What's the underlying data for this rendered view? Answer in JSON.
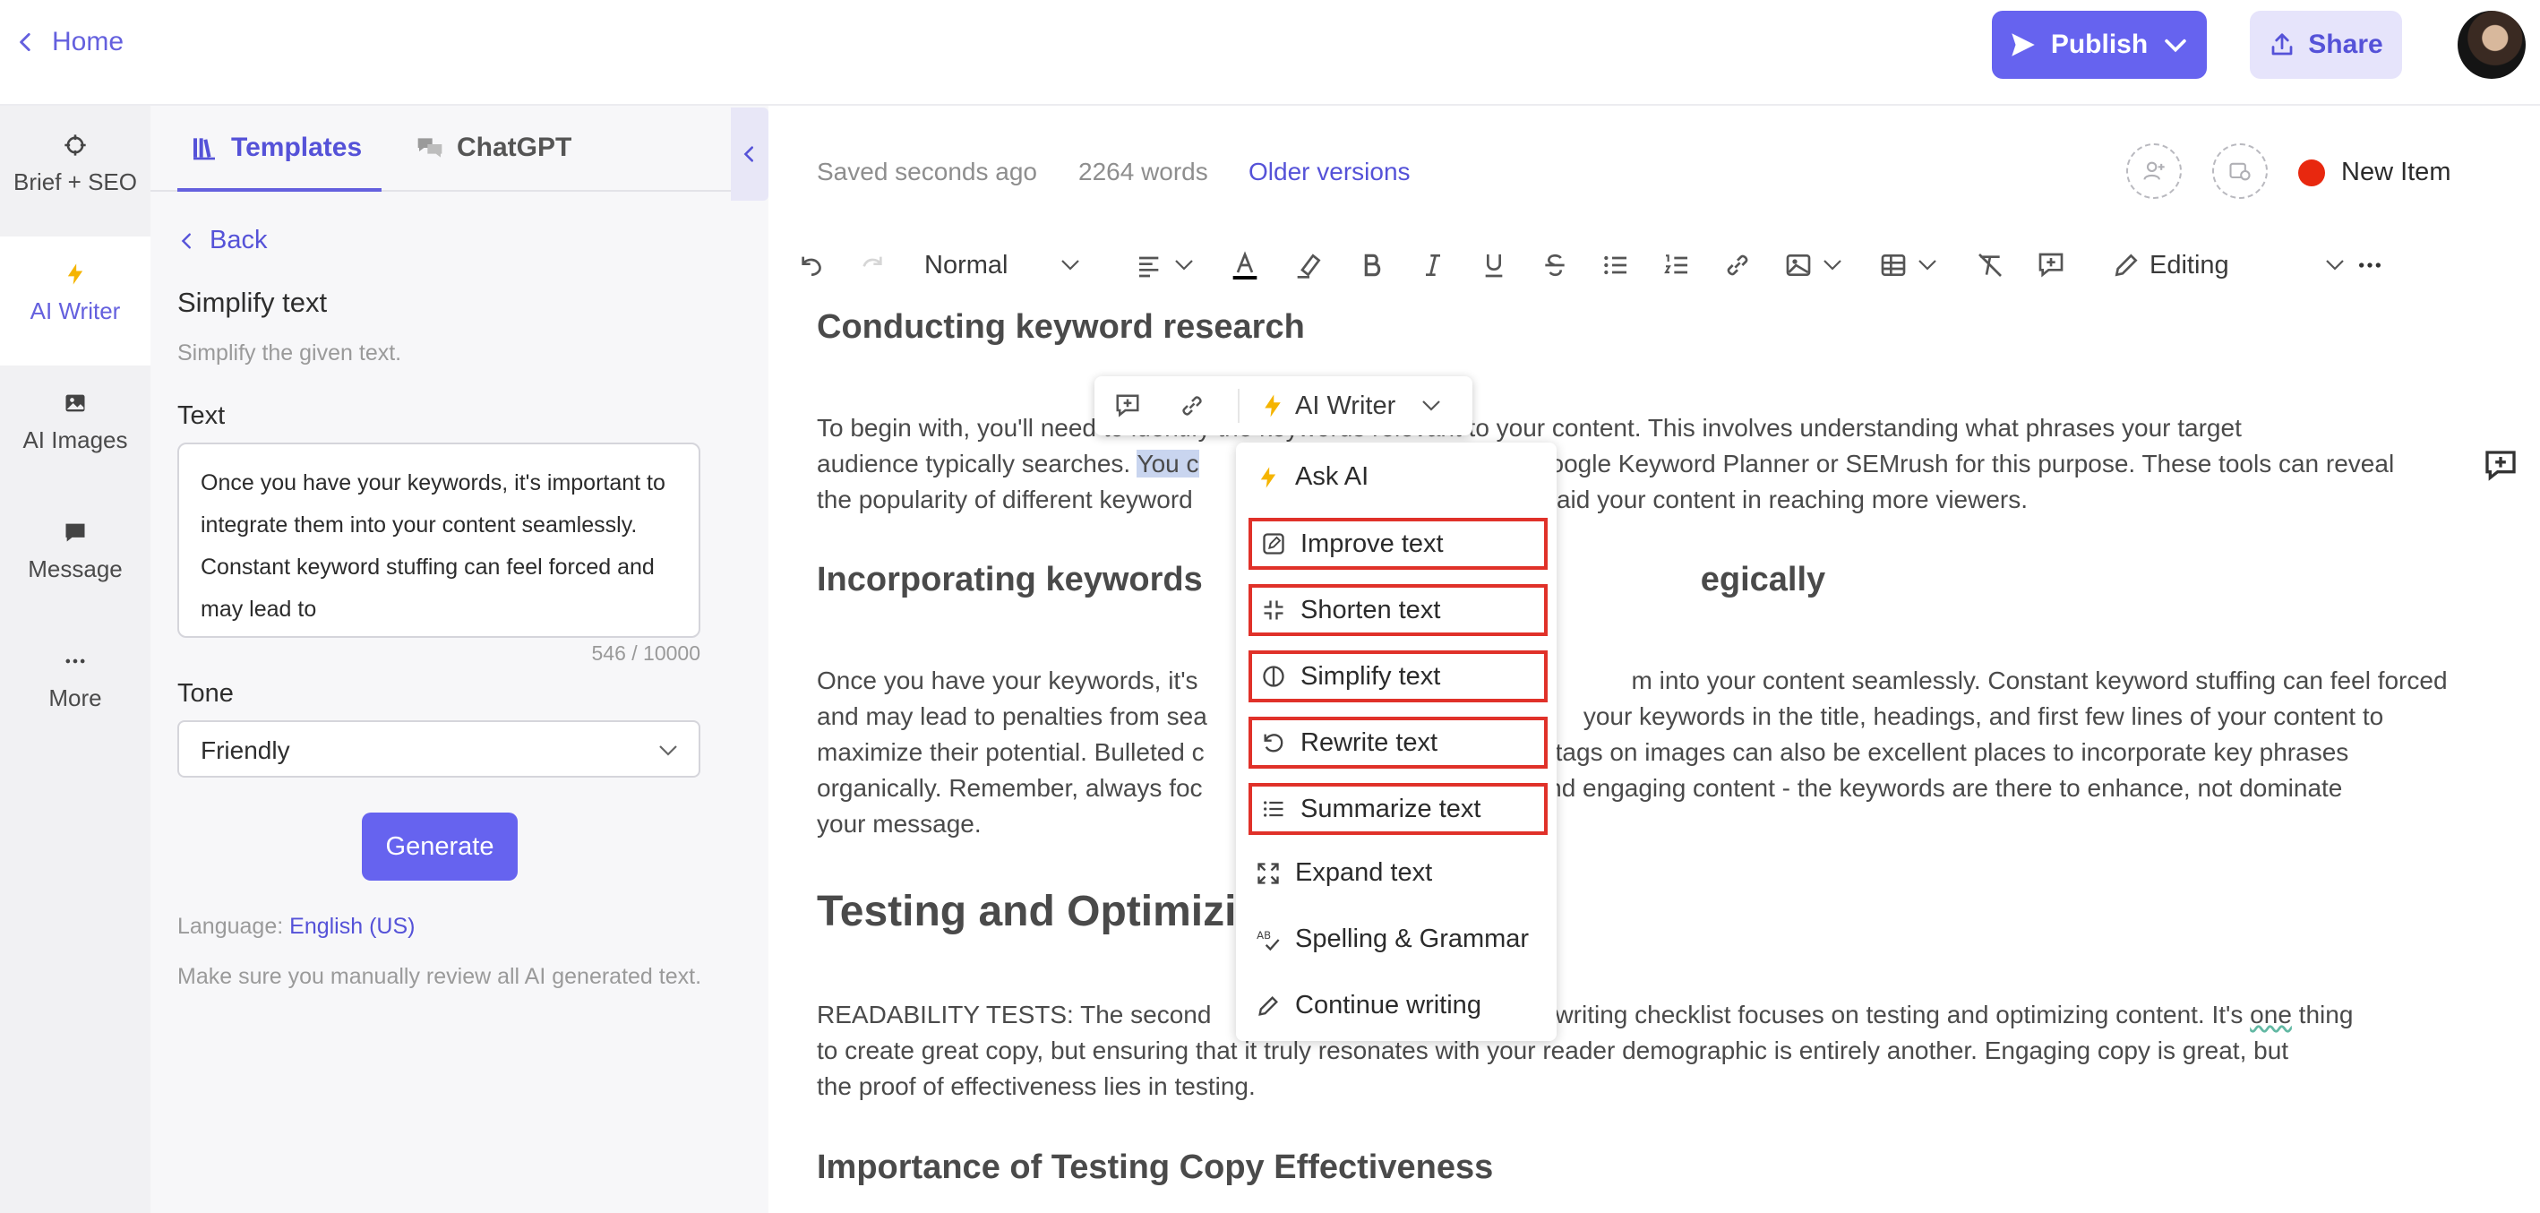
{
  "header": {
    "home_label": "Home",
    "publish_label": "Publish",
    "share_label": "Share"
  },
  "rail": {
    "items": [
      {
        "label": "Brief + SEO",
        "icon": "crosshair-icon"
      },
      {
        "label": "AI Writer",
        "icon": "lightning-icon"
      },
      {
        "label": "AI Images",
        "icon": "image-icon"
      },
      {
        "label": "Message",
        "icon": "message-icon"
      },
      {
        "label": "More",
        "icon": "dots-icon"
      }
    ]
  },
  "panel": {
    "tabs": [
      {
        "label": "Templates",
        "icon": "library-icon"
      },
      {
        "label": "ChatGPT",
        "icon": "chat-bubbles-icon"
      }
    ],
    "back_label": "Back",
    "title": "Simplify text",
    "subtitle": "Simplify the given text.",
    "text_label": "Text",
    "text_value": "Once you have your keywords, it's important to integrate them into your content seamlessly. Constant keyword stuffing can feel forced and may lead to",
    "counter": "546 / 10000",
    "tone_label": "Tone",
    "tone_value": "Friendly",
    "generate_label": "Generate",
    "language_prefix": "Language:",
    "language_value": "English (US)",
    "disclaimer": "Make sure you manually review all AI generated text."
  },
  "editor": {
    "saved": "Saved seconds ago",
    "words": "2264 words",
    "older_versions": "Older versions",
    "new_item_label": "New Item",
    "new_item_color": "#e8280f",
    "toolbar": {
      "style": "Normal",
      "mode": "Editing"
    }
  },
  "document": {
    "heading1": "Conducting keyword research",
    "para1_line1": "To begin with, you'll need to identify the keywords relevant to your content. This involves understanding what phrases your target",
    "para1_line2a": "audience typically searches.",
    "para1_line2_sel": "You c",
    "para1_line2b": "oogle Keyword Planner or SEMrush for this purpose. These tools can reveal",
    "para1_line3a": "the popularity of different keyword",
    "para1_line3b": "might aid your content in reaching more viewers.",
    "heading2a": "Incorporating keywords",
    "heading2b": "egically",
    "para2_line1a": "Once you have your keywords, it's",
    "para2_line1b": "m into your content seamlessly. Constant keyword stuffing can feel forced",
    "para2_line2a": "and may lead to penalties from sea",
    "para2_line2b": "your keywords in the title, headings, and first few lines of your content to",
    "para2_line3a": "maximize their potential. Bulleted c",
    "para2_line3b": "tags on images can also be excellent places to incorporate key phrases",
    "para2_line4a": "organically. Remember, always foc",
    "para2_line4b": "and engaging content - the keywords are there to enhance, not dominate",
    "para2_line5": "your message.",
    "heading3": "Testing and Optimizi",
    "para3_line1a": "READABILITY TESTS: The second",
    "para3_line1b": "ywriting checklist focuses on testing and optimizing content. It's",
    "para3_line1_sq": "one",
    "para3_line1c": "thing",
    "para3_line2": "to create great copy, but ensuring that it truly resonates with your reader demographic is entirely another. Engaging copy is great, but",
    "para3_line3": "the proof of effectiveness lies in testing.",
    "heading4": "Importance of Testing Copy Effectiveness"
  },
  "bubble": {
    "ai_writer_label": "AI Writer"
  },
  "menu": {
    "items": [
      {
        "label": "Ask AI",
        "icon": "lightning-icon"
      },
      {
        "label": "Improve text",
        "icon": "edit-square-icon"
      },
      {
        "label": "Shorten text",
        "icon": "shrink-icon"
      },
      {
        "label": "Simplify text",
        "icon": "circle-half-icon"
      },
      {
        "label": "Rewrite text",
        "icon": "rotate-icon"
      },
      {
        "label": "Summarize text",
        "icon": "list-icon"
      },
      {
        "label": "Expand text",
        "icon": "expand-icon"
      },
      {
        "label": "Spelling & Grammar",
        "icon": "spellcheck-icon"
      },
      {
        "label": "Continue writing",
        "icon": "pencil-icon"
      }
    ],
    "highlight_color": "#e03129"
  }
}
